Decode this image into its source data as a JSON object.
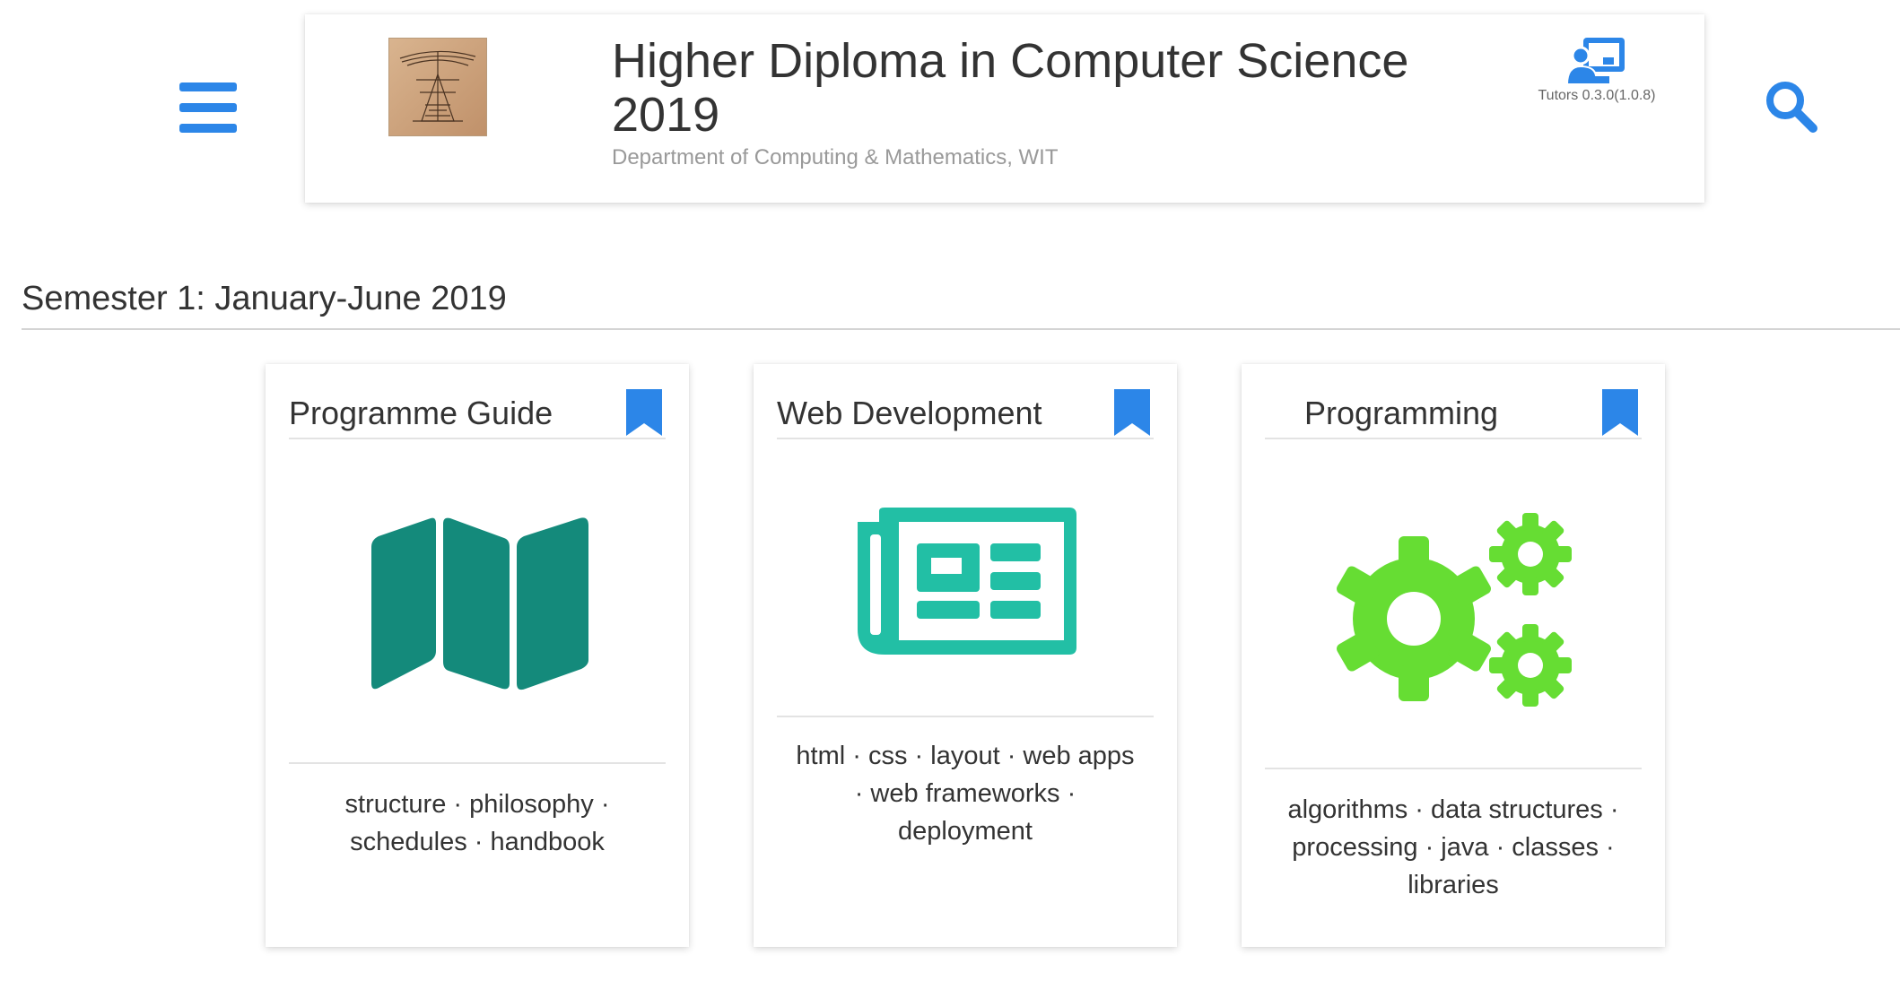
{
  "header": {
    "title": "Higher Diploma in Computer Science 2019",
    "subtitle": "Department of Computing & Mathematics, WIT",
    "version": "Tutors 0.3.0(1.0.8)",
    "menu_icon": "hamburger-menu-icon",
    "search_icon": "search-icon",
    "tutors_icon": "tutor-presentation-icon",
    "accent_color": "#2c86e8"
  },
  "section": {
    "title": "Semester 1: January-June 2019"
  },
  "cards": [
    {
      "title": "Programme Guide",
      "description": "structure · philosophy · schedules · handbook",
      "icon": "map-icon",
      "icon_color": "#148a7b"
    },
    {
      "title": "Web Development",
      "description": "html · css · layout · web apps · web frameworks · deployment",
      "icon": "newspaper-icon",
      "icon_color": "#22bfa5"
    },
    {
      "title": "Programming",
      "description": "algorithms · data structures · processing · java · classes · libraries",
      "icon": "gears-icon",
      "icon_color": "#66dd33"
    }
  ]
}
